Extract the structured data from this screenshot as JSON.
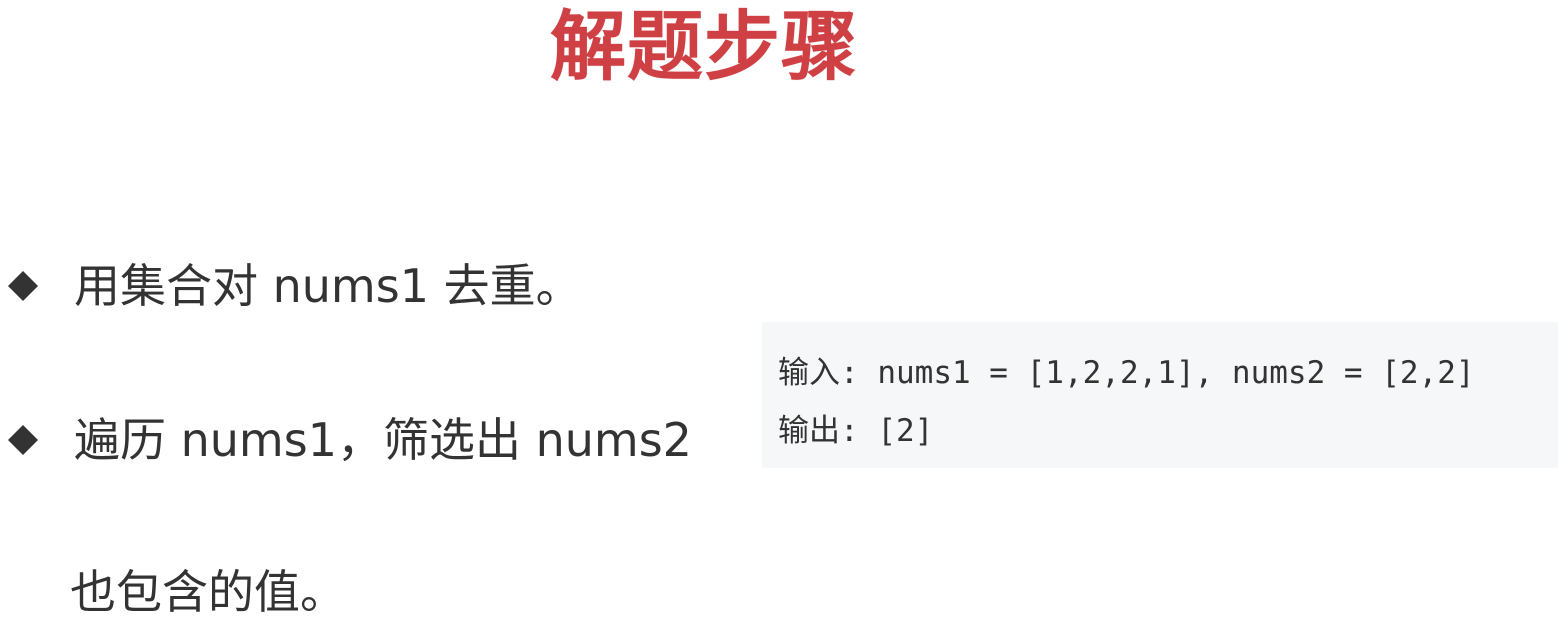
{
  "title": "解题步骤",
  "bullets": [
    {
      "icon": "diamond-bullet-icon",
      "text": "用集合对 nums1 去重。"
    },
    {
      "icon": "diamond-bullet-icon",
      "text": "遍历 nums1，筛选出 nums2",
      "continuation": "也包含的值。"
    }
  ],
  "example": {
    "input_line": "输入: nums1 = [1,2,2,1], nums2 = [2,2]",
    "output_line": "输出: [2]"
  },
  "colors": {
    "title": "#cf4044",
    "text": "#333333",
    "code_background": "#f6f7f9"
  }
}
